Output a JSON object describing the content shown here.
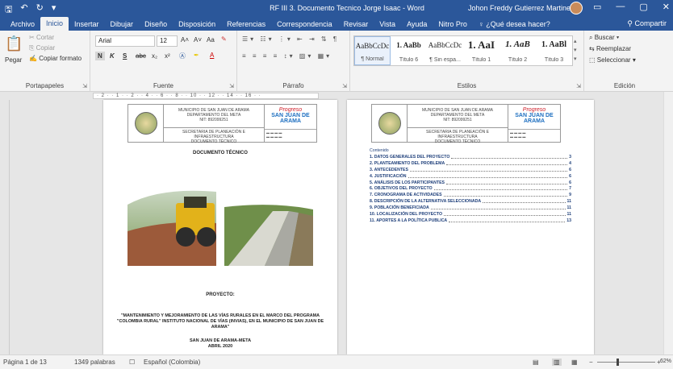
{
  "window": {
    "title": "RF III 3. Documento Tecnico Jorge Isaac  -  Word",
    "user": "Johon Freddy Gutierrez Martinez",
    "qat": [
      "save-icon",
      "undo-icon",
      "redo-icon",
      "customize-icon"
    ],
    "controls": [
      "ribbon-display-icon",
      "minimize-icon",
      "maximize-icon",
      "close-icon"
    ],
    "controls_glyphs": [
      "▭",
      "—",
      "▢",
      "✕"
    ]
  },
  "tabs": [
    "Archivo",
    "Inicio",
    "Insertar",
    "Dibujar",
    "Diseño",
    "Disposición",
    "Referencias",
    "Correspondencia",
    "Revisar",
    "Vista",
    "Ayuda",
    "Nitro Pro"
  ],
  "tell_me": "¿Qué desea hacer?",
  "share": "Compartir",
  "ribbon": {
    "clipboard": {
      "label": "Portapapeles",
      "paste": "Pegar",
      "cut": "Cortar",
      "copy": "Copiar",
      "format": "Copiar formato"
    },
    "font": {
      "label": "Fuente",
      "name": "Arial",
      "size": "12",
      "bold": "N",
      "italic": "K",
      "underline": "S",
      "strike": "abc",
      "sub": "x₂",
      "sup": "x²",
      "grow": "A˄",
      "shrink": "A˅",
      "case": "Aa"
    },
    "paragraph": {
      "label": "Párrafo"
    },
    "styles": {
      "label": "Estilos",
      "items": [
        {
          "sample": "AaBbCcDc",
          "name": "¶ Normal"
        },
        {
          "sample": "1. AaBb",
          "name": "Título 6"
        },
        {
          "sample": "AaBbCcDc",
          "name": "¶ Sin espa..."
        },
        {
          "sample": "1. AaI",
          "name": "Título 1"
        },
        {
          "sample": "1. AaB",
          "name": "Título 2"
        },
        {
          "sample": "1. AaBl",
          "name": "Título 3"
        }
      ]
    },
    "editing": {
      "label": "Edición",
      "find": "Buscar",
      "replace": "Reemplazar",
      "select": "Seleccionar"
    }
  },
  "page1": {
    "header": {
      "org1": "MUNICIPIO DE SAN JUAN DE ARAMA",
      "org2": "DEPARTAMENTO DEL META",
      "nit": "NIT: 892099251",
      "sec1": "SECRETARIA DE PLANEACIÓN E",
      "sec2": "INFRAESTRUCTURA",
      "doc": "DOCUMENTO TÉCNICO",
      "brand1": "Progreso",
      "brand2": "SAN JUAN DE ARAMA"
    },
    "doc_title": "DOCUMENTO TÉCNICO",
    "project_label": "PROYECTO:",
    "description": "\"MANTENIMIENTO Y MEJORAMIENTO DE LAS VÍAS RURALES EN EL MARCO DEL PROGRAMA \"COLOMBIA RURAL\" INSTITUTO NACIONAL DE VÍAS (INVIAS), EN EL MUNICIPIO DE SAN JUAN DE ARAMA\"",
    "place": "SAN JUAN DE ARAMA-META",
    "date": "ABRIL 2020"
  },
  "page2": {
    "toc_heading": "Contenido",
    "toc": [
      {
        "n": "1.",
        "t": "DATOS GENERALES DEL PROYECTO",
        "p": "3"
      },
      {
        "n": "2.",
        "t": "PLANTEAMIENTO DEL PROBLEMA",
        "p": "4"
      },
      {
        "n": "3.",
        "t": "ANTECEDENTES",
        "p": "6"
      },
      {
        "n": "4.",
        "t": "JUSTIFICACIÓN",
        "p": "6"
      },
      {
        "n": "5.",
        "t": "ANÁLISIS DE LOS PARTICIPANTES",
        "p": "6"
      },
      {
        "n": "6.",
        "t": "OBJETIVOS DEL PROYECTO",
        "p": "7"
      },
      {
        "n": "7.",
        "t": "CRONOGRAMA DE ACTIVIDADES",
        "p": "9"
      },
      {
        "n": "8.",
        "t": "DESCRIPCIÓN DE LA ALTERNATIVA SELECCIONADA",
        "p": "11"
      },
      {
        "n": "9.",
        "t": "POBLACIÓN BENEFICIADA",
        "p": "11"
      },
      {
        "n": "10.",
        "t": "LOCALIZACIÓN DEL PROYECTO",
        "p": "11"
      },
      {
        "n": "11.",
        "t": "APORTES A LA POLÍTICA PUBLICA",
        "p": "13"
      }
    ]
  },
  "status": {
    "page": "Página 1 de 13",
    "words": "1349 palabras",
    "lang": "Español (Colombia)",
    "zoom": "62%"
  },
  "colors": {
    "accent": "#2b579a",
    "toc": "#1e3f7a",
    "brand_red": "#d0202a",
    "brand_blue": "#1e6fc0"
  }
}
